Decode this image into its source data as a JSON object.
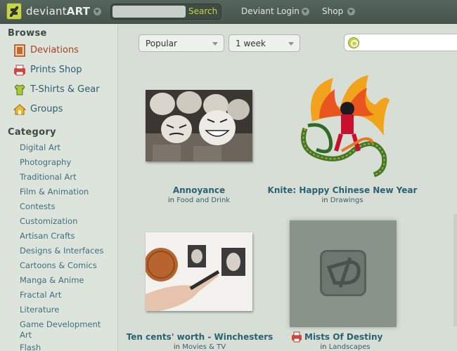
{
  "header": {
    "logo_text_light": "deviant",
    "logo_text_bold": "ART",
    "search_placeholder": "",
    "search_button": "Search",
    "login_label": "Deviant Login",
    "shop_label": "Shop"
  },
  "sidebar": {
    "browse_heading": "Browse",
    "nav": [
      {
        "label": "Deviations",
        "icon": "deviations-icon",
        "active": true
      },
      {
        "label": "Prints Shop",
        "icon": "prints-icon",
        "active": false
      },
      {
        "label": "T-Shirts & Gear",
        "icon": "tshirt-icon",
        "active": false
      },
      {
        "label": "Groups",
        "icon": "groups-house-icon",
        "active": false
      }
    ],
    "category_heading": "Category",
    "categories": [
      "Digital Art",
      "Photography",
      "Traditional Art",
      "Film & Animation",
      "Contests",
      "Customization",
      "Artisan Crafts",
      "Designs & Interfaces",
      "Cartoons & Comics",
      "Manga & Anime",
      "Fractal Art",
      "Literature",
      "Game Development Art",
      "Flash"
    ]
  },
  "filters": {
    "sort": "Popular",
    "period": "1 week",
    "search_value": ""
  },
  "deviations": [
    {
      "title": "Annoyance",
      "in": "in",
      "category": "Food and Drink"
    },
    {
      "title": "Knite: Happy Chinese New Year",
      "in": "in",
      "category": "Drawings"
    },
    {
      "title": "Ten cents' worth - Winchesters",
      "in": "in",
      "category": "Movies & TV"
    },
    {
      "title": "Mists Of Destiny",
      "in": "in",
      "category": "Landscapes"
    }
  ],
  "colors": {
    "accent": "#c8d34a",
    "link": "#2b6272",
    "active": "#a9421c"
  }
}
